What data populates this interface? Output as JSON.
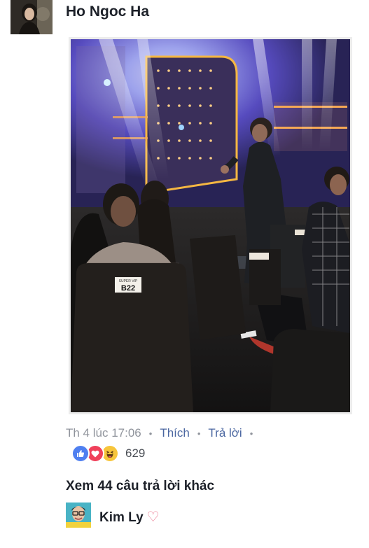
{
  "post": {
    "author": "Ho Ngoc Ha",
    "photo": {
      "seat_tag_top": "SUPER VIP",
      "seat_tag_code": "B22"
    }
  },
  "comment_meta": {
    "time": "Th 4 lúc 17:06",
    "separator": "•",
    "like_label": "Thích",
    "reply_label": "Trả lời"
  },
  "reactions": {
    "icons": [
      "like-icon",
      "love-icon",
      "haha-icon"
    ],
    "count": "629",
    "colors": {
      "like": "#4f7ff0",
      "love": "#f0405a",
      "haha": "#f7c53b"
    }
  },
  "replies": {
    "more_label": "Xem 44 câu trả lời khác",
    "preview_author": "Kim Ly",
    "preview_emoji": "♡"
  }
}
